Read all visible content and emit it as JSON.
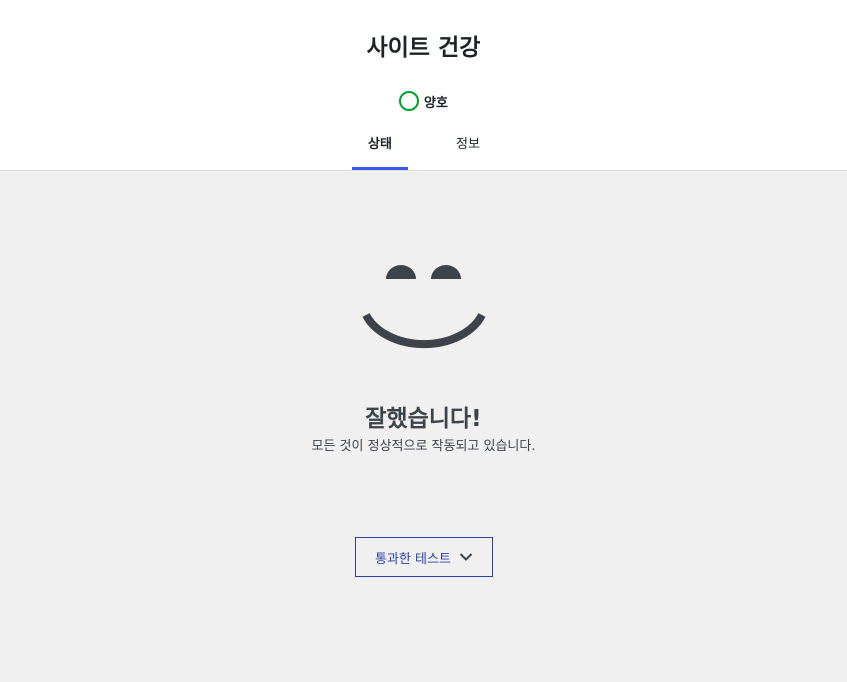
{
  "header": {
    "title": "사이트 건강",
    "rating": {
      "label": "양호",
      "color": "#00a32a"
    },
    "tabs": [
      {
        "label": "상태",
        "active": true
      },
      {
        "label": "정보",
        "active": false
      }
    ]
  },
  "main": {
    "icon": "smiley-face-icon",
    "heading": "잘했습니다!",
    "description": "모든 것이 정상적으로 작동되고 있습니다.",
    "passed_tests_button": {
      "label": "통과한 테스트",
      "icon": "chevron-down-icon"
    }
  },
  "colors": {
    "accent": "#3858e9",
    "button": "#2c3fa7",
    "text": "#1d2327",
    "muted": "#3c434a",
    "background": "#f0f0f1"
  }
}
